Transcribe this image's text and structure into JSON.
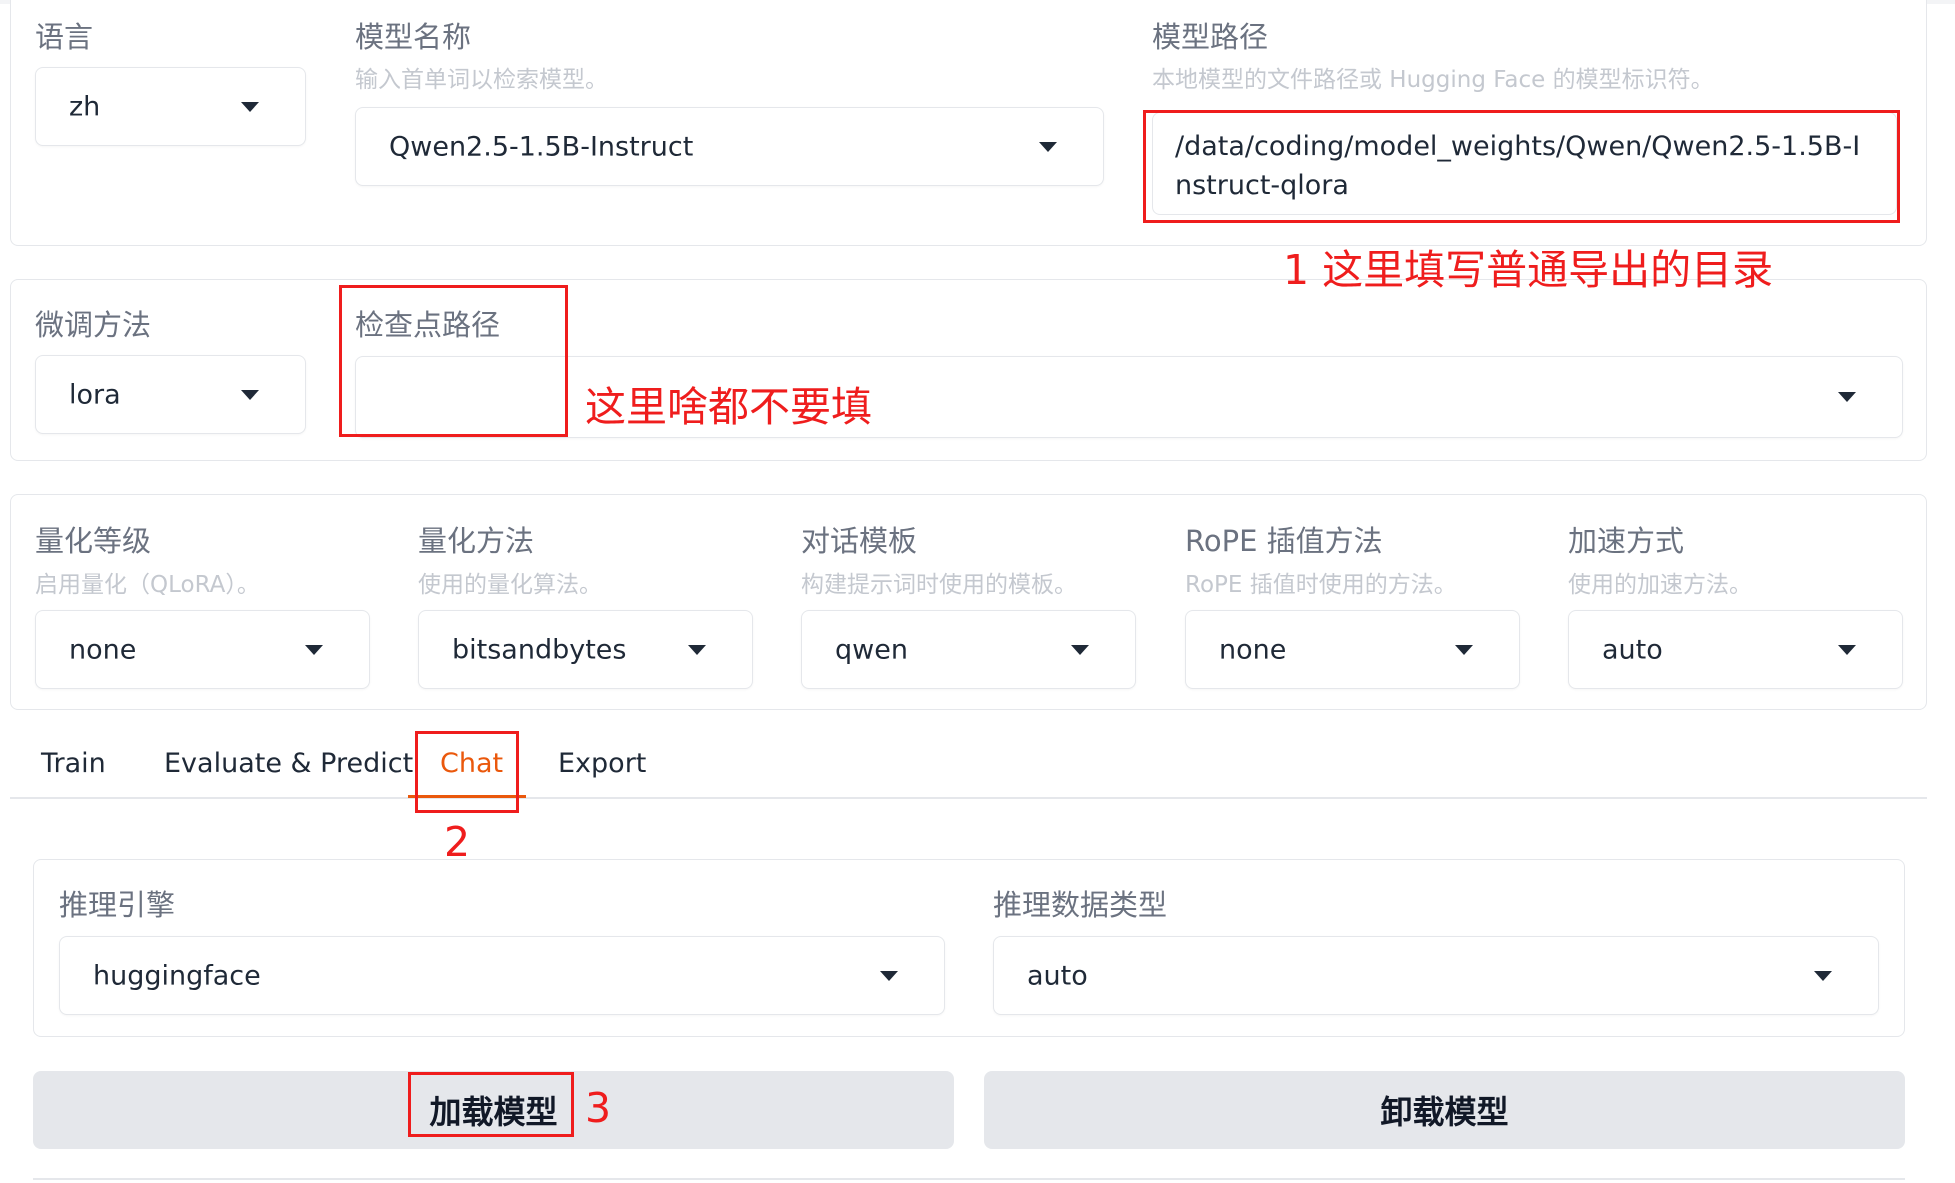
{
  "top_panel": {
    "language": {
      "label": "语言",
      "value": "zh"
    },
    "model_name": {
      "label": "模型名称",
      "info": "输入首单词以检索模型。",
      "value": "Qwen2.5-1.5B-Instruct"
    },
    "model_path": {
      "label": "模型路径",
      "info": "本地模型的文件路径或 Hugging Face 的模型标识符。",
      "value": "/data/coding/model_weights/Qwen/Qwen2.5-1.5B-Instruct-qlora"
    }
  },
  "finetune_panel": {
    "method": {
      "label": "微调方法",
      "value": "lora"
    },
    "checkpoint": {
      "label": "检查点路径",
      "value": ""
    }
  },
  "quant_panel": {
    "quant_level": {
      "label": "量化等级",
      "info": "启用量化（QLoRA）。",
      "value": "none"
    },
    "quant_method": {
      "label": "量化方法",
      "info": "使用的量化算法。",
      "value": "bitsandbytes"
    },
    "template": {
      "label": "对话模板",
      "info": "构建提示词时使用的模板。",
      "value": "qwen"
    },
    "rope": {
      "label": "RoPE 插值方法",
      "info": "RoPE 插值时使用的方法。",
      "value": "none"
    },
    "booster": {
      "label": "加速方式",
      "info": "使用的加速方法。",
      "value": "auto"
    }
  },
  "tabs": [
    {
      "label": "Train",
      "active": false
    },
    {
      "label": "Evaluate & Predict",
      "active": false
    },
    {
      "label": "Chat",
      "active": true
    },
    {
      "label": "Export",
      "active": false
    }
  ],
  "chat_panel": {
    "infer_backend": {
      "label": "推理引擎",
      "value": "huggingface"
    },
    "infer_dtype": {
      "label": "推理数据类型",
      "value": "auto"
    }
  },
  "buttons": {
    "load_model": "加载模型",
    "unload_model": "卸载模型"
  },
  "annotations": {
    "note_1": "1 这里填写普通导出的目录",
    "note_checkpoint": "这里啥都不要填",
    "num_2": "2",
    "num_3": "3"
  },
  "colors": {
    "accent": "#ea580c",
    "annotation_red": "#ef1d1d",
    "button_bg": "#e5e7eb"
  },
  "icons": [
    "chevron-down-icon"
  ]
}
